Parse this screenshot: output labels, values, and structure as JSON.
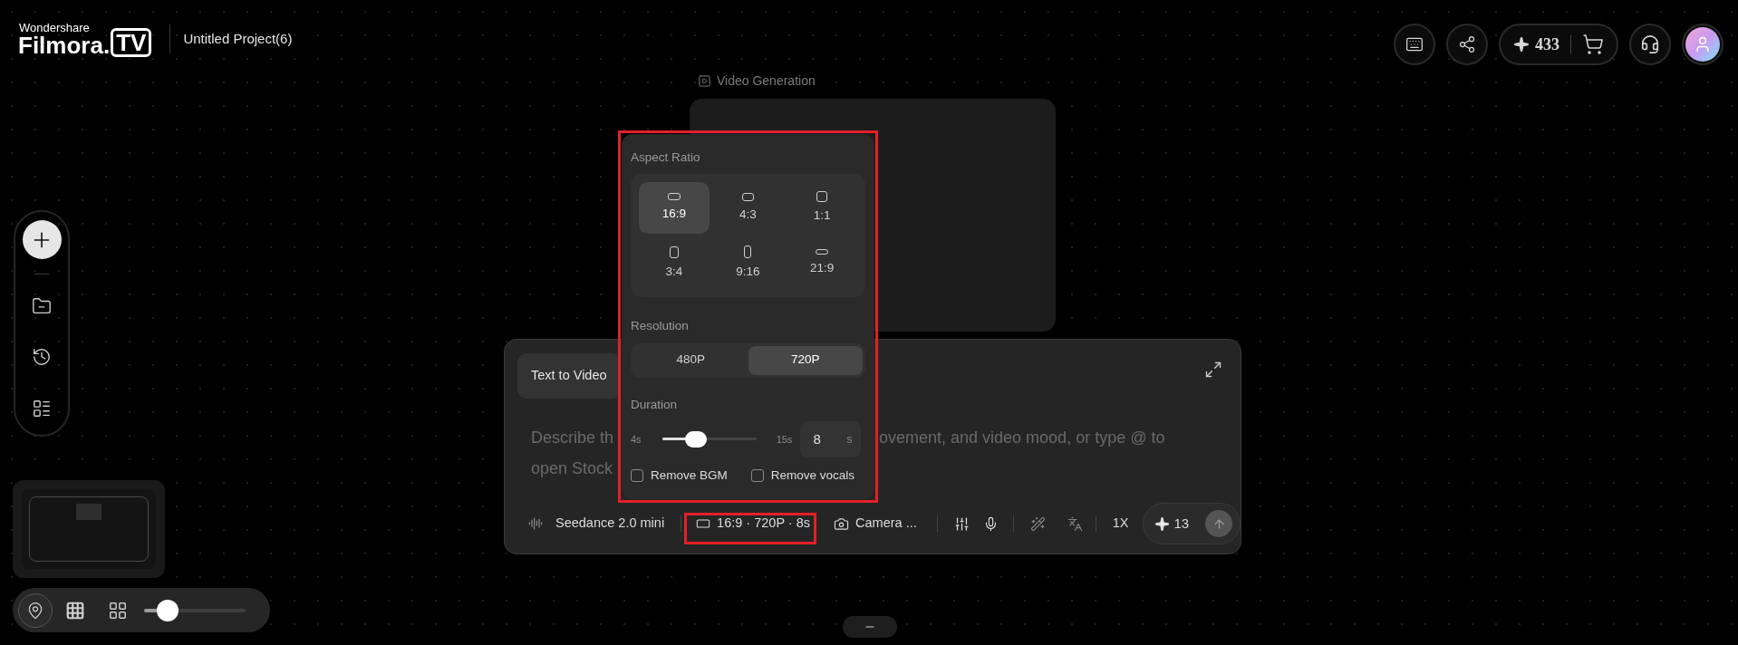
{
  "header": {
    "brand_top": "Wondershare",
    "brand_name": "Filmora.",
    "brand_badge": "TV",
    "project_title": "Untitled Project(6)",
    "credits": "433"
  },
  "canvas": {
    "node_label": "Video Generation"
  },
  "prompt": {
    "tab": "Text to Video",
    "placeholder_parts": [
      "Describe th",
      "ovement, and video mood, or type @ to",
      "open Stock"
    ],
    "model": "Seedance 2.0 mini",
    "settings_summary": "16:9 · 720P · 8s",
    "camera": "Camera ...",
    "speed": "1X",
    "cost": "13"
  },
  "popup": {
    "aspect_title": "Aspect Ratio",
    "ratios": [
      {
        "label": "16:9",
        "kind": "wide",
        "selected": true
      },
      {
        "label": "4:3",
        "kind": "landscape",
        "selected": false
      },
      {
        "label": "1:1",
        "kind": "square",
        "selected": false
      },
      {
        "label": "3:4",
        "kind": "portrait",
        "selected": false
      },
      {
        "label": "9:16",
        "kind": "tall",
        "selected": false
      },
      {
        "label": "21:9",
        "kind": "ultrawide",
        "selected": false
      }
    ],
    "resolution_title": "Resolution",
    "resolutions": [
      {
        "label": "480P",
        "selected": false
      },
      {
        "label": "720P",
        "selected": true
      }
    ],
    "duration_title": "Duration",
    "min": "4s",
    "max": "15s",
    "level": 0.364,
    "value": "8",
    "unit": "s",
    "options": [
      {
        "label": "Remove BGM",
        "checked": false
      },
      {
        "label": "Remove vocals",
        "checked": false
      }
    ]
  },
  "zoom_bar": {
    "level": 0.23
  }
}
